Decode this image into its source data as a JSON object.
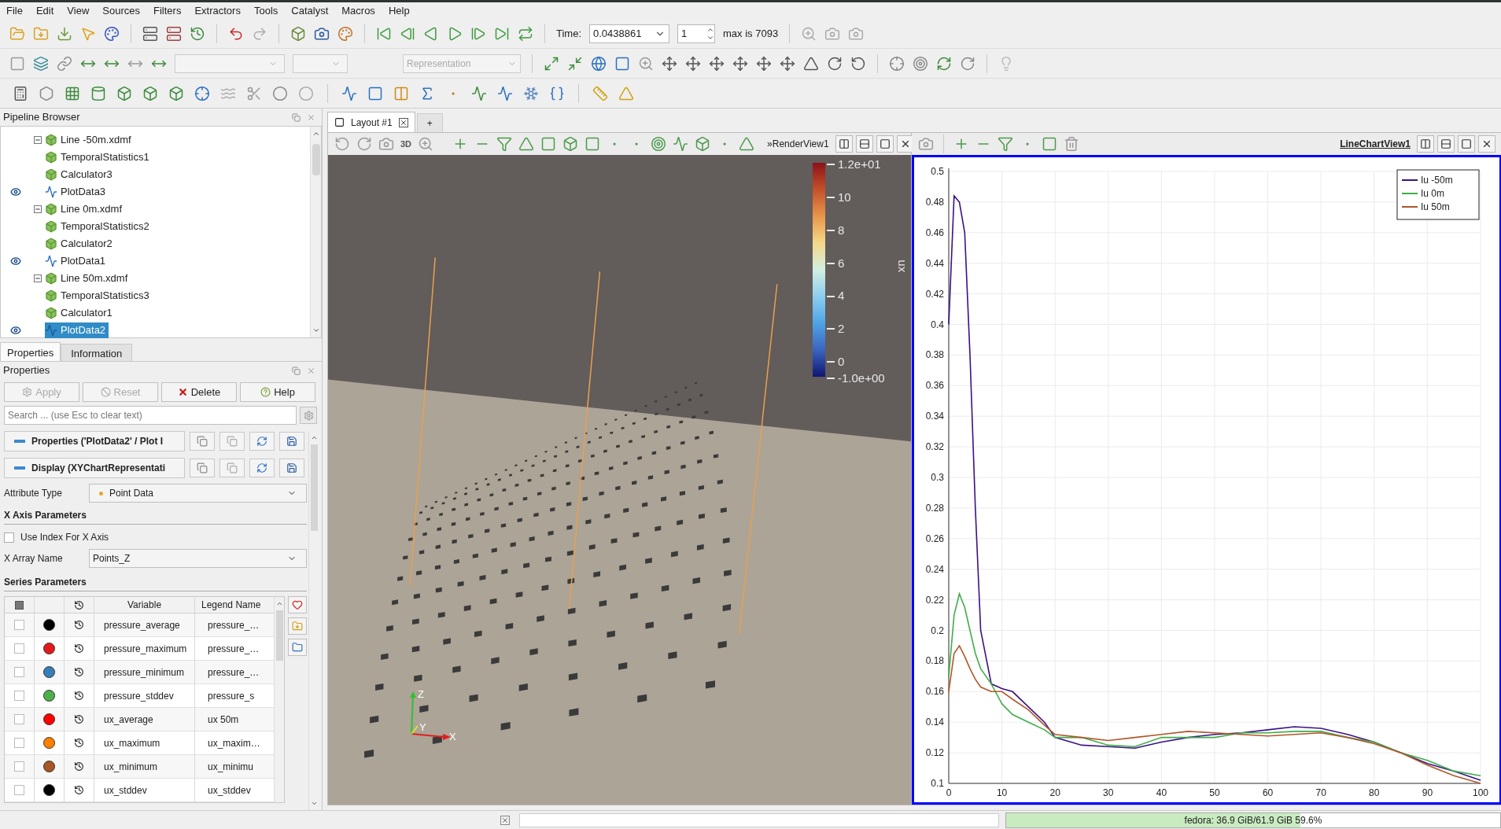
{
  "menu": [
    "File",
    "Edit",
    "View",
    "Sources",
    "Filters",
    "Extractors",
    "Tools",
    "Catalyst",
    "Macros",
    "Help"
  ],
  "toolbar": {
    "time_label": "Time:",
    "time_value": "0.0438861",
    "step_value": "1",
    "max_label": "max is 7093",
    "representation_placeholder": "Representation"
  },
  "pipeline_browser": {
    "title": "Pipeline Browser",
    "items": [
      {
        "label": "Line -50m.xdmf",
        "kind": "source",
        "visible": false,
        "selected": false,
        "expanded": true,
        "children": [
          {
            "label": "TemporalStatistics1",
            "kind": "filter",
            "visible": false,
            "selected": false
          },
          {
            "label": "Calculator3",
            "kind": "filter",
            "visible": false,
            "selected": false
          },
          {
            "label": "PlotData3",
            "kind": "plot",
            "visible": true,
            "selected": false
          }
        ]
      },
      {
        "label": "Line 0m.xdmf",
        "kind": "source",
        "visible": false,
        "selected": false,
        "expanded": true,
        "children": [
          {
            "label": "TemporalStatistics2",
            "kind": "filter",
            "visible": false,
            "selected": false
          },
          {
            "label": "Calculator2",
            "kind": "filter",
            "visible": false,
            "selected": false
          },
          {
            "label": "PlotData1",
            "kind": "plot",
            "visible": true,
            "selected": false
          }
        ]
      },
      {
        "label": "Line 50m.xdmf",
        "kind": "source",
        "visible": false,
        "selected": false,
        "expanded": true,
        "children": [
          {
            "label": "TemporalStatistics3",
            "kind": "filter",
            "visible": false,
            "selected": false
          },
          {
            "label": "Calculator1",
            "kind": "filter",
            "visible": false,
            "selected": false
          },
          {
            "label": "PlotData2",
            "kind": "plot",
            "visible": true,
            "selected": true
          }
        ]
      }
    ]
  },
  "panel_tabs": [
    {
      "label": "Properties",
      "selected": true
    },
    {
      "label": "Information",
      "selected": false
    }
  ],
  "properties": {
    "title": "Properties",
    "buttons": [
      {
        "label": "Apply",
        "kind": "apply",
        "disabled": true
      },
      {
        "label": "Reset",
        "kind": "reset",
        "disabled": true
      },
      {
        "label": "Delete",
        "kind": "delete",
        "disabled": false
      },
      {
        "label": "Help",
        "kind": "help",
        "disabled": false
      }
    ],
    "search_placeholder": "Search ... (use Esc to clear text)",
    "sections": [
      "Properties ('PlotData2' / Plot I",
      "Display (XYChartRepresentati"
    ],
    "attribute_type": {
      "label": "Attribute Type",
      "value": "Point Data"
    },
    "x_axis_heading": "X Axis Parameters",
    "use_index": {
      "label": "Use Index For X Axis",
      "checked": false
    },
    "x_array": {
      "label": "X Array Name",
      "value": "Points_Z"
    },
    "series_heading": "Series Parameters",
    "series_table": {
      "select_all_checked": false,
      "select_all_partial": true,
      "columns": [
        "Variable",
        "Legend Name"
      ],
      "rows": [
        {
          "checked": false,
          "color": "#000000",
          "variable": "pressure_average",
          "legend": "pressure_…"
        },
        {
          "checked": false,
          "color": "#e31a1c",
          "variable": "pressure_maximum",
          "legend": "pressure_…"
        },
        {
          "checked": false,
          "color": "#377eb8",
          "variable": "pressure_minimum",
          "legend": "pressure_…"
        },
        {
          "checked": false,
          "color": "#4daf4a",
          "variable": "pressure_stddev",
          "legend": "pressure_s"
        },
        {
          "checked": false,
          "color": "#ff0000",
          "variable": "ux_average",
          "legend": "ux 50m"
        },
        {
          "checked": false,
          "color": "#ff7f00",
          "variable": "ux_maximum",
          "legend": "ux_maxim…"
        },
        {
          "checked": false,
          "color": "#a65628",
          "variable": "ux_minimum",
          "legend": "ux_minimu"
        },
        {
          "checked": false,
          "color": "#000000",
          "variable": "ux_stddev",
          "legend": "ux_stddev"
        }
      ]
    }
  },
  "layout_tabs": [
    {
      "label": "Layout #1",
      "selected": true
    }
  ],
  "add_tab": "+",
  "render_view": {
    "mode_button": "3D",
    "axes_labels": [
      "Z",
      "Y",
      "X"
    ],
    "title": "»RenderView1",
    "colorbar": {
      "title": "ux",
      "max_label": "1.2e+01",
      "min_label": "-1.0e+00",
      "ticks": [
        "10",
        "8",
        "6",
        "4",
        "2",
        "0"
      ]
    }
  },
  "chart_view": {
    "title": "LineChartView1",
    "active": true,
    "chart_data": {
      "type": "line",
      "grid": true,
      "legend": true,
      "x": [
        0,
        1,
        2,
        3,
        4,
        5,
        6,
        8,
        10,
        12,
        15,
        18,
        20,
        25,
        30,
        35,
        40,
        45,
        50,
        55,
        60,
        65,
        70,
        75,
        80,
        85,
        90,
        95,
        100
      ],
      "series": [
        {
          "name": "Iu -50m",
          "color": "#3a1286",
          "values": [
            0.4,
            0.484,
            0.48,
            0.46,
            0.38,
            0.28,
            0.2,
            0.165,
            0.162,
            0.16,
            0.15,
            0.14,
            0.13,
            0.125,
            0.124,
            0.123,
            0.127,
            0.13,
            0.132,
            0.133,
            0.135,
            0.137,
            0.136,
            0.132,
            0.127,
            0.12,
            0.113,
            0.108,
            0.102
          ]
        },
        {
          "name": "Iu 0m",
          "color": "#3fae49",
          "values": [
            0.17,
            0.21,
            0.224,
            0.215,
            0.2,
            0.185,
            0.175,
            0.165,
            0.152,
            0.145,
            0.14,
            0.135,
            0.13,
            0.13,
            0.125,
            0.124,
            0.13,
            0.13,
            0.13,
            0.133,
            0.133,
            0.134,
            0.134,
            0.13,
            0.127,
            0.12,
            0.115,
            0.108,
            0.105
          ]
        },
        {
          "name": "Iu 50m",
          "color": "#b0562a",
          "values": [
            0.16,
            0.185,
            0.19,
            0.183,
            0.175,
            0.168,
            0.163,
            0.16,
            0.16,
            0.155,
            0.148,
            0.138,
            0.132,
            0.13,
            0.128,
            0.13,
            0.132,
            0.134,
            0.133,
            0.132,
            0.131,
            0.132,
            0.133,
            0.13,
            0.126,
            0.12,
            0.112,
            0.105,
            0.1
          ]
        }
      ],
      "xlim": [
        0,
        100
      ],
      "ylim": [
        0.1,
        0.5
      ],
      "xticks": [
        {
          "value": 0,
          "label": "0"
        },
        {
          "value": 10,
          "label": "10"
        },
        {
          "value": 20,
          "label": "20"
        },
        {
          "value": 30,
          "label": "30"
        },
        {
          "value": 40,
          "label": "40"
        },
        {
          "value": 50,
          "label": "50"
        },
        {
          "value": 60,
          "label": "60"
        },
        {
          "value": 70,
          "label": "70"
        },
        {
          "value": 80,
          "label": "80"
        },
        {
          "value": 90,
          "label": "90"
        },
        {
          "value": 100,
          "label": "100"
        }
      ],
      "yticks": [
        0.1,
        0.12,
        0.14,
        0.16,
        0.18,
        0.2,
        0.22,
        0.24,
        0.26,
        0.28,
        0.3,
        0.32,
        0.34,
        0.36,
        0.38,
        0.4,
        0.42,
        0.44,
        0.46,
        0.48,
        0.5
      ]
    }
  },
  "status_bar": {
    "memory": "fedora: 36.9 GiB/61.9 GiB 59.6%",
    "level": 0.596
  }
}
